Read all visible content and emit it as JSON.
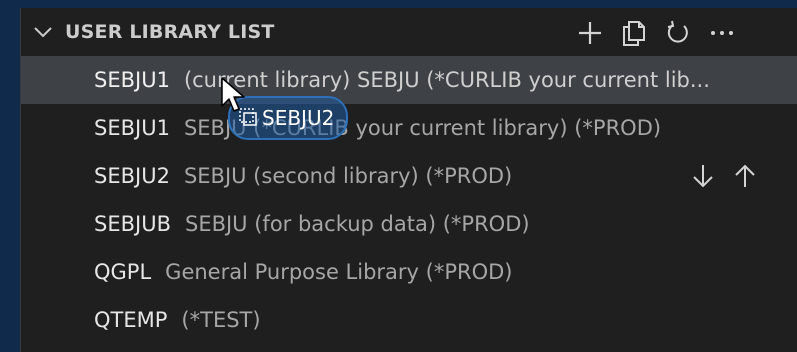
{
  "header": {
    "title": "USER LIBRARY LIST"
  },
  "actions": [
    {
      "name": "add-icon",
      "label": "Add library"
    },
    {
      "name": "copy-icon",
      "label": "Copy"
    },
    {
      "name": "refresh-icon",
      "label": "Refresh"
    },
    {
      "name": "more-icon",
      "label": "More actions"
    }
  ],
  "list": {
    "items": [
      {
        "lib": "SEBJU1",
        "desc": "(current library) SEBJU (*CURLIB your current lib..."
      },
      {
        "lib": "SEBJU1",
        "desc": "SEBJU (*CURLIB your current library) (*PROD)"
      },
      {
        "lib": "SEBJU2",
        "desc": "SEBJU (second library) (*PROD)"
      },
      {
        "lib": "SEBJUB",
        "desc": "SEBJU (for backup data) (*PROD)"
      },
      {
        "lib": "QGPL",
        "desc": "General Purpose Library (*PROD)"
      },
      {
        "lib": "QTEMP",
        "desc": "(*TEST)"
      }
    ]
  },
  "drag": {
    "label": "SEBJU2"
  },
  "colors": {
    "panel_bg": "#1f1f1f",
    "selected_bg": "#3e4145",
    "drag_border": "#2d6fb8"
  }
}
